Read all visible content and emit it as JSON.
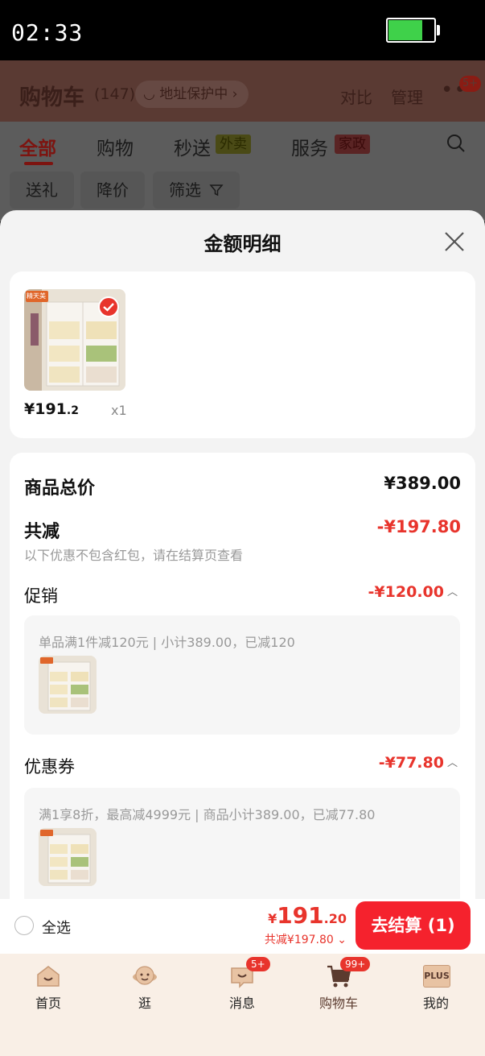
{
  "status_bar": {
    "time": "02:33",
    "battery_level": 0.75,
    "battery_color": "#3fd14a"
  },
  "cart_header": {
    "title": "购物车",
    "count": "(147)",
    "address_pill": "地址保护中",
    "compare": "对比",
    "manage": "管理",
    "more_badge": "5+"
  },
  "category_tabs": {
    "all": "全部",
    "shopping": "购物",
    "flash": "秒送",
    "flash_tag": "外卖",
    "service": "服务",
    "service_tag": "家政"
  },
  "filters": {
    "gift": "送礼",
    "price_drop": "降价",
    "filter": "筛选"
  },
  "sheet": {
    "title": "金额明细",
    "item": {
      "price_int": "¥191",
      "price_dec": ".2",
      "qty": "x1",
      "store_tag": "精天美"
    },
    "goods_total_label": "商品总价",
    "goods_total_value": "¥389.00",
    "total_reduce_label": "共减",
    "total_reduce_value": "-¥197.80",
    "total_reduce_note": "以下优惠不包含红包，请在结算页查看",
    "promo_label": "促销",
    "promo_value": "-¥120.00",
    "promo_detail": "单品满1件减120元 | 小计389.00，已减120",
    "coupon_label": "优惠券",
    "coupon_value": "-¥77.80",
    "coupon_detail": "满1享8折，最高减4999元 | 商品小计389.00，已减77.80"
  },
  "checkout": {
    "select_all": "全选",
    "currency": "¥",
    "price_int": "191",
    "price_dec": ".20",
    "saved": "共减¥197.80",
    "button": "去结算 (1)"
  },
  "bottom_nav": {
    "home": "首页",
    "browse": "逛",
    "messages": "消息",
    "messages_badge": "5+",
    "cart": "购物车",
    "cart_badge": "99+",
    "mine": "我的",
    "plus": "PLUS"
  },
  "colors": {
    "accent_red": "#e8342c",
    "checkout_red": "#f5222d",
    "nav_bg": "#f9efe6"
  }
}
